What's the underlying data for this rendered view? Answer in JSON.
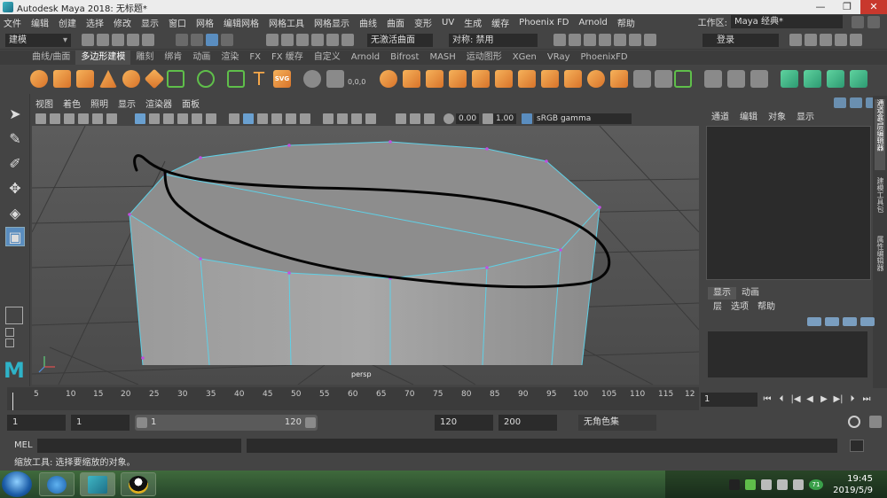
{
  "window": {
    "title": "Autodesk Maya 2018: 无标题*",
    "buttons": [
      "—",
      "❐",
      "✕"
    ]
  },
  "menubar": {
    "items": [
      "文件",
      "编辑",
      "创建",
      "选择",
      "修改",
      "显示",
      "窗口",
      "网格",
      "编辑网格",
      "网格工具",
      "网格显示",
      "曲线",
      "曲面",
      "变形",
      "UV",
      "生成",
      "缓存",
      "Phoenix FD",
      "Arnold",
      "帮助"
    ],
    "workspace_label": "工作区:",
    "workspace_value": "Maya 经典*"
  },
  "statusline": {
    "mode": "建模",
    "live_surface": "无激活曲面",
    "symmetry": "对称: 禁用",
    "login": "登录"
  },
  "shelf": {
    "tabs": [
      "曲线/曲面",
      "多边形建模",
      "雕刻",
      "绑肯",
      "动画",
      "渲染",
      "FX",
      "FX 缓存",
      "自定义",
      "Arnold",
      "Bifrost",
      "MASH",
      "运动图形",
      "XGen",
      "VRay",
      "PhoenixFD"
    ],
    "active_tab": "多边形建模",
    "text_icon": "T",
    "svg_icon": "SVG",
    "xyz_icon": "0,0,0"
  },
  "viewport": {
    "menu": [
      "视图",
      "着色",
      "照明",
      "显示",
      "渲染器",
      "面板"
    ],
    "exposure": "0.00",
    "gamma": "1.00",
    "color_space": "sRGB gamma",
    "camera_label": "persp"
  },
  "channel_box": {
    "tabs": [
      "通道",
      "编辑",
      "对象",
      "显示"
    ],
    "side_tabs": [
      "通道盒/层编辑器",
      "建模工具包",
      "属性编辑器"
    ]
  },
  "layer_editor": {
    "tabs": [
      "显示",
      "动画"
    ],
    "menu": [
      "层",
      "选项",
      "帮助"
    ]
  },
  "time_slider": {
    "ticks": [
      "5",
      "10",
      "15",
      "20",
      "25",
      "30",
      "35",
      "40",
      "45",
      "50",
      "55",
      "60",
      "65",
      "70",
      "75",
      "80",
      "85",
      "90",
      "95",
      "100",
      "105",
      "110",
      "115",
      "12"
    ],
    "current_frame": "1",
    "playback_icons": [
      "⏮",
      "⏴",
      "|◀",
      "◀",
      "▶",
      "▶|",
      "⏵",
      "⏭"
    ]
  },
  "range_slider": {
    "start": "1",
    "playback_start": "1",
    "range_start": "1",
    "range_end": "120",
    "playback_end": "120",
    "end": "200",
    "character_set": "无角色集"
  },
  "command_line": {
    "label": "MEL"
  },
  "help_line": "缩放工具: 选择要缩放的对象。",
  "taskbar": {
    "clock_time": "19:45",
    "clock_date": "2019/5/9",
    "badge": "71"
  }
}
